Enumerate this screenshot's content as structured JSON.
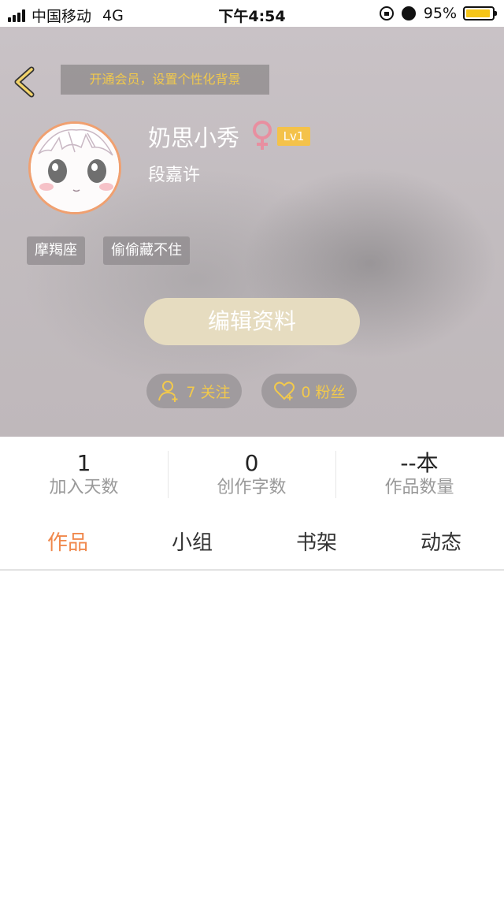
{
  "status_bar": {
    "carrier": "中国移动",
    "network": "4G",
    "time": "下午4:54",
    "battery_percent": "95%",
    "battery_level": 0.95
  },
  "header": {
    "vip_banner": "开通会员，设置个性化背景",
    "username": "奶思小秀",
    "gender_symbol": "♀",
    "level": "Lv1",
    "real_name": "段嘉许",
    "tags": [
      "摩羯座",
      "偷偷藏不住"
    ],
    "edit_button": "编辑资料",
    "following": "7 关注",
    "followers": "0 粉丝"
  },
  "stats": [
    {
      "value": "1",
      "label": "加入天数"
    },
    {
      "value": "0",
      "label": "创作字数"
    },
    {
      "value": "--本",
      "label": "作品数量"
    }
  ],
  "tabs": [
    "作品",
    "小组",
    "书架",
    "动态"
  ],
  "active_tab": "作品",
  "colors": {
    "accent": "#f0884c",
    "gold": "#f2c94c",
    "edit_button": "#e6dcc0",
    "gender": "#e88fa0"
  },
  "icons": [
    "back-icon",
    "lock-rotation-icon",
    "alarm-icon",
    "battery-icon",
    "female-icon",
    "follow-user-icon",
    "heart-icon"
  ]
}
